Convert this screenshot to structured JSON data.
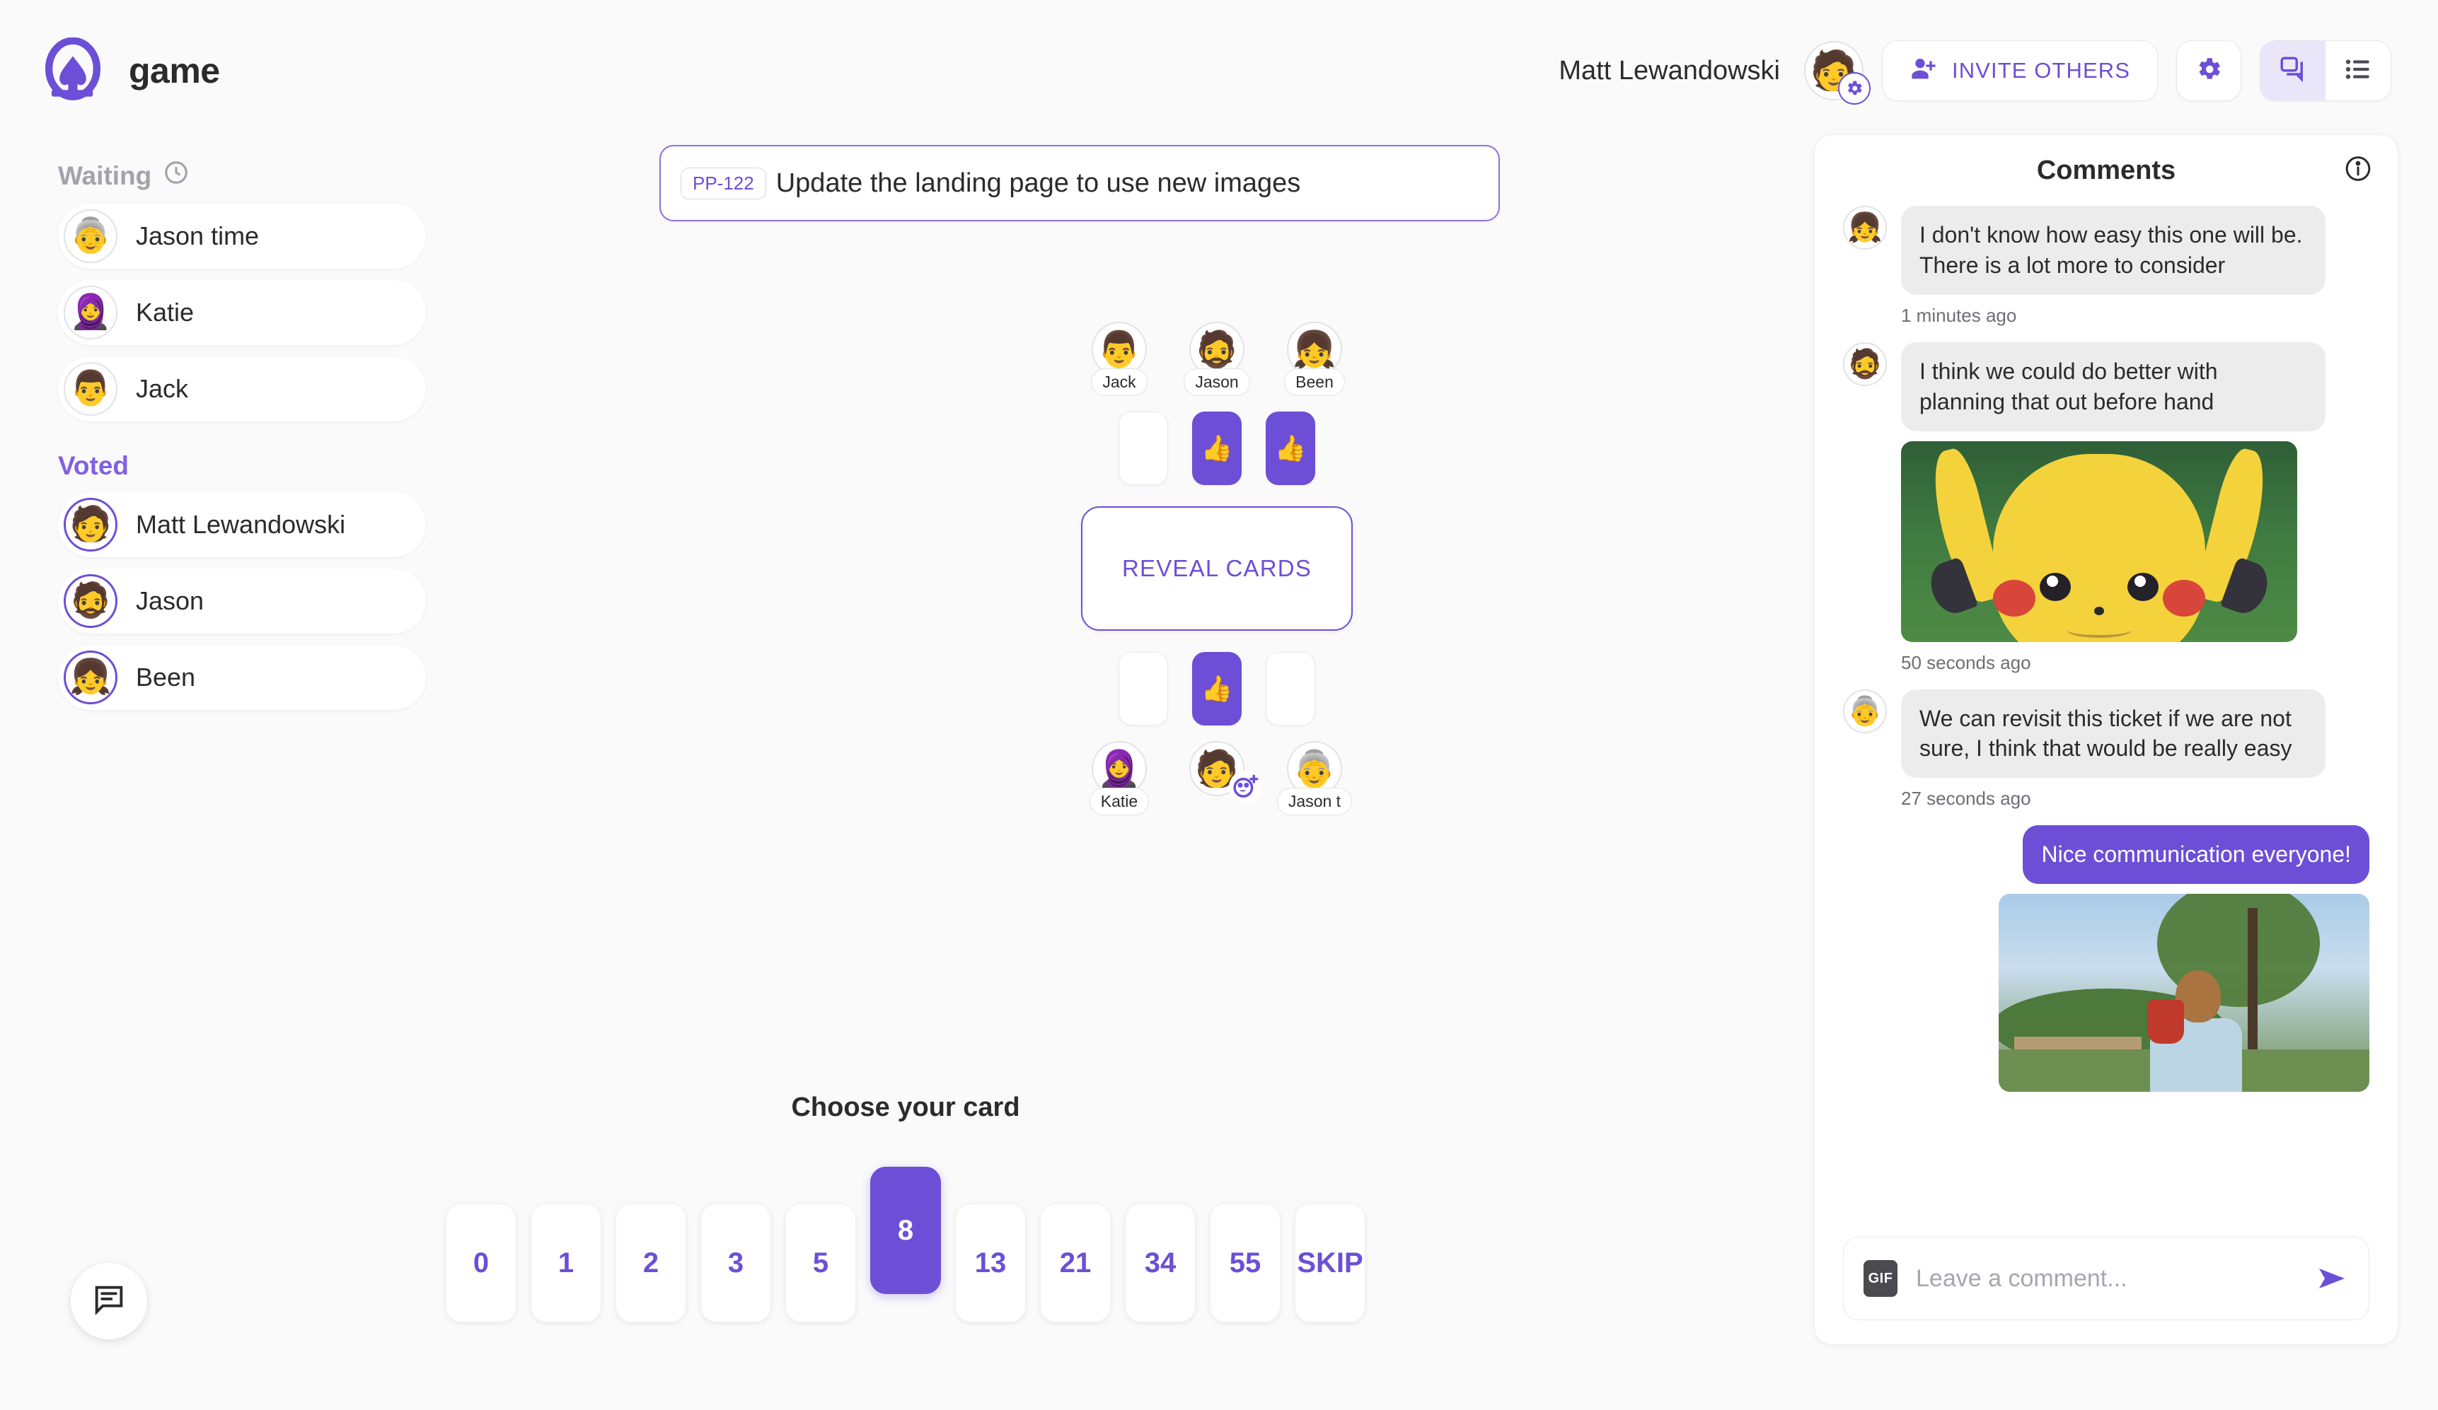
{
  "app": {
    "brand_name": "game",
    "logo_icon": "spade-logo-icon",
    "accent_color": "#6c4fd6",
    "background_color": "#fafafa"
  },
  "header": {
    "user_name": "Matt Lewandowski",
    "user_avatar_emoji": "🧑",
    "gear_badge_icon": "gear-icon",
    "invite_label": "INVITE OTHERS",
    "invite_icon": "person-add-icon",
    "settings_icon": "gear-icon",
    "view_toggle": [
      {
        "icon": "chat-bubbles-icon",
        "active": true
      },
      {
        "icon": "list-icon",
        "active": false
      }
    ]
  },
  "sidebar": {
    "waiting": {
      "title": "Waiting",
      "icon": "clock-icon",
      "players": [
        {
          "name": "Jason time",
          "avatar": "👵",
          "voted": false
        },
        {
          "name": "Katie",
          "avatar": "🧕",
          "voted": false
        },
        {
          "name": "Jack",
          "avatar": "👨",
          "voted": false
        }
      ]
    },
    "voted": {
      "title": "Voted",
      "players": [
        {
          "name": "Matt Lewandowski",
          "avatar": "🧑",
          "voted": true
        },
        {
          "name": "Jason",
          "avatar": "🧔",
          "voted": true
        },
        {
          "name": "Been",
          "avatar": "👧",
          "voted": true
        }
      ]
    }
  },
  "ticket": {
    "id": "PP-122",
    "title": "Update the landing page to use new images"
  },
  "table": {
    "reveal_label": "REVEAL CARDS",
    "top_seats": [
      {
        "name": "Jack",
        "avatar": "👨",
        "has_voted": false,
        "card_face": ""
      },
      {
        "name": "Jason",
        "avatar": "🧔",
        "has_voted": true,
        "card_face": "👍"
      },
      {
        "name": "Been",
        "avatar": "👧",
        "has_voted": true,
        "card_face": "👍"
      }
    ],
    "bottom_seats": [
      {
        "name": "Katie",
        "avatar": "🧕",
        "has_voted": false,
        "card_face": ""
      },
      {
        "name": "",
        "avatar": "🧑",
        "has_voted": true,
        "card_face": "👍",
        "reaction_badge": "add-reaction-icon"
      },
      {
        "name": "Jason t",
        "avatar": "👵",
        "has_voted": false,
        "card_face": ""
      }
    ]
  },
  "deck": {
    "prompt": "Choose your card",
    "cards": [
      {
        "label": "0",
        "selected": false
      },
      {
        "label": "1",
        "selected": false
      },
      {
        "label": "2",
        "selected": false
      },
      {
        "label": "3",
        "selected": false
      },
      {
        "label": "5",
        "selected": false
      },
      {
        "label": "8",
        "selected": true
      },
      {
        "label": "13",
        "selected": false
      },
      {
        "label": "21",
        "selected": false
      },
      {
        "label": "34",
        "selected": false
      },
      {
        "label": "55",
        "selected": false
      },
      {
        "label": "SKIP",
        "selected": false
      }
    ]
  },
  "comments_panel": {
    "title": "Comments",
    "info_icon": "info-icon",
    "comments": [
      {
        "author_avatar": "👧",
        "text": "I don't know how easy this one will be. There is a lot more to consider",
        "time": "1 minutes ago",
        "mine": false,
        "media": null
      },
      {
        "author_avatar": "🧔",
        "text": "I think we could do better with planning that out before hand",
        "time": "50 seconds ago",
        "mine": false,
        "media": "sad-pikachu-gif"
      },
      {
        "author_avatar": "👵",
        "text": "We can revisit this ticket if we are not sure, I think that would be really easy",
        "time": "27 seconds ago",
        "mine": false,
        "media": null
      },
      {
        "author_avatar": "🧑",
        "text": "Nice communication everyone!",
        "time": "",
        "mine": true,
        "media": "person-drinking-park-gif"
      }
    ],
    "composer": {
      "gif_label": "GIF",
      "placeholder": "Leave a comment...",
      "value": "",
      "send_icon": "send-arrow-icon"
    }
  },
  "fab": {
    "icon": "chat-bubble-icon"
  }
}
